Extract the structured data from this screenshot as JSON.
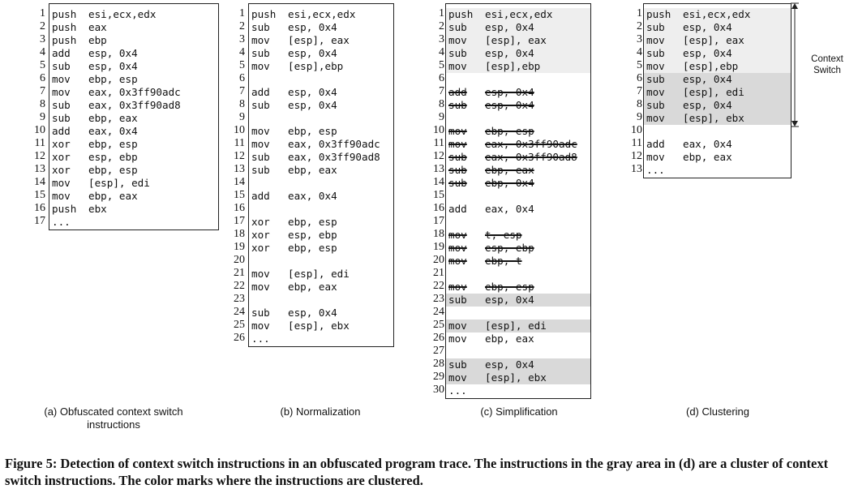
{
  "panels": [
    {
      "id": "a",
      "caption": "(a) Obfuscated context switch instructions",
      "rows": [
        {
          "n": "1",
          "op": "push",
          "args": "esi,ecx,edx",
          "style": ""
        },
        {
          "n": "2",
          "op": "push",
          "args": "eax",
          "style": ""
        },
        {
          "n": "3",
          "op": "push",
          "args": "ebp",
          "style": ""
        },
        {
          "n": "4",
          "op": "add",
          "args": "esp, 0x4",
          "style": ""
        },
        {
          "n": "5",
          "op": "sub",
          "args": "esp, 0x4",
          "style": ""
        },
        {
          "n": "6",
          "op": "mov",
          "args": "ebp, esp",
          "style": ""
        },
        {
          "n": "7",
          "op": "mov",
          "args": "eax, 0x3ff90adc",
          "style": ""
        },
        {
          "n": "8",
          "op": "sub",
          "args": "eax, 0x3ff90ad8",
          "style": ""
        },
        {
          "n": "9",
          "op": "sub",
          "args": "ebp, eax",
          "style": ""
        },
        {
          "n": "10",
          "op": "add",
          "args": "eax, 0x4",
          "style": ""
        },
        {
          "n": "11",
          "op": "xor",
          "args": "ebp, esp",
          "style": ""
        },
        {
          "n": "12",
          "op": "xor",
          "args": "esp, ebp",
          "style": ""
        },
        {
          "n": "13",
          "op": "xor",
          "args": "ebp, esp",
          "style": ""
        },
        {
          "n": "14",
          "op": "mov",
          "args": "[esp], edi",
          "style": ""
        },
        {
          "n": "15",
          "op": "mov",
          "args": "ebp, eax",
          "style": ""
        },
        {
          "n": "16",
          "op": "push",
          "args": "ebx",
          "style": ""
        },
        {
          "n": "17",
          "op": "...",
          "args": "",
          "style": ""
        }
      ]
    },
    {
      "id": "b",
      "caption": "(b) Normalization",
      "rows": [
        {
          "n": "1",
          "op": "push",
          "args": "esi,ecx,edx",
          "style": ""
        },
        {
          "n": "2",
          "op": "sub",
          "args": "esp, 0x4",
          "style": ""
        },
        {
          "n": "3",
          "op": "mov",
          "args": "[esp], eax",
          "style": ""
        },
        {
          "n": "4",
          "op": "sub",
          "args": "esp, 0x4",
          "style": ""
        },
        {
          "n": "5",
          "op": "mov",
          "args": "[esp],ebp",
          "style": ""
        },
        {
          "n": "6",
          "op": "",
          "args": "",
          "style": ""
        },
        {
          "n": "7",
          "op": "add",
          "args": "esp, 0x4",
          "style": ""
        },
        {
          "n": "8",
          "op": "sub",
          "args": "esp, 0x4",
          "style": ""
        },
        {
          "n": "9",
          "op": "",
          "args": "",
          "style": ""
        },
        {
          "n": "10",
          "op": "mov",
          "args": "ebp, esp",
          "style": ""
        },
        {
          "n": "11",
          "op": "mov",
          "args": "eax, 0x3ff90adc",
          "style": ""
        },
        {
          "n": "12",
          "op": "sub",
          "args": "eax, 0x3ff90ad8",
          "style": ""
        },
        {
          "n": "13",
          "op": "sub",
          "args": "ebp, eax",
          "style": ""
        },
        {
          "n": "14",
          "op": "",
          "args": "",
          "style": ""
        },
        {
          "n": "15",
          "op": "add",
          "args": "eax, 0x4",
          "style": ""
        },
        {
          "n": "16",
          "op": "",
          "args": "",
          "style": ""
        },
        {
          "n": "17",
          "op": "xor",
          "args": "ebp, esp",
          "style": ""
        },
        {
          "n": "18",
          "op": "xor",
          "args": "esp, ebp",
          "style": ""
        },
        {
          "n": "19",
          "op": "xor",
          "args": "ebp, esp",
          "style": ""
        },
        {
          "n": "20",
          "op": "",
          "args": "",
          "style": ""
        },
        {
          "n": "21",
          "op": "mov",
          "args": "[esp], edi",
          "style": ""
        },
        {
          "n": "22",
          "op": "mov",
          "args": "ebp, eax",
          "style": ""
        },
        {
          "n": "23",
          "op": "",
          "args": "",
          "style": ""
        },
        {
          "n": "24",
          "op": "sub",
          "args": "esp, 0x4",
          "style": ""
        },
        {
          "n": "25",
          "op": "mov",
          "args": "[esp], ebx",
          "style": ""
        },
        {
          "n": "26",
          "op": "...",
          "args": "",
          "style": ""
        }
      ]
    },
    {
      "id": "c",
      "caption": "(c) Simplification",
      "rows": [
        {
          "n": "1",
          "op": "push",
          "args": "esi,ecx,edx",
          "style": "hl"
        },
        {
          "n": "2",
          "op": "sub",
          "args": "esp, 0x4",
          "style": "hl"
        },
        {
          "n": "3",
          "op": "mov",
          "args": "[esp], eax",
          "style": "hl"
        },
        {
          "n": "4",
          "op": "sub",
          "args": "esp, 0x4",
          "style": "hl"
        },
        {
          "n": "5",
          "op": "mov",
          "args": "[esp],ebp",
          "style": "hl"
        },
        {
          "n": "6",
          "op": "",
          "args": "",
          "style": ""
        },
        {
          "n": "7",
          "op": "add",
          "args": "esp, 0x4",
          "style": "strike"
        },
        {
          "n": "8",
          "op": "sub",
          "args": "esp, 0x4",
          "style": "strike"
        },
        {
          "n": "9",
          "op": "",
          "args": "",
          "style": ""
        },
        {
          "n": "10",
          "op": "mov",
          "args": "ebp, esp",
          "style": "strike"
        },
        {
          "n": "11",
          "op": "mov",
          "args": "eax, 0x3ff90adc",
          "style": "strike"
        },
        {
          "n": "12",
          "op": "sub",
          "args": "eax, 0x3ff90ad8",
          "style": "strike"
        },
        {
          "n": "13",
          "op": "sub",
          "args": "ebp, eax",
          "style": "strike"
        },
        {
          "n": "14",
          "op": "sub",
          "args": "ebp, 0x4",
          "style": "strike"
        },
        {
          "n": "15",
          "op": "",
          "args": "",
          "style": ""
        },
        {
          "n": "16",
          "op": "add",
          "args": "eax, 0x4",
          "style": ""
        },
        {
          "n": "17",
          "op": "",
          "args": "",
          "style": ""
        },
        {
          "n": "18",
          "op": "mov",
          "args": "t, esp",
          "style": "strike"
        },
        {
          "n": "19",
          "op": "mov",
          "args": "esp, ebp",
          "style": "strike"
        },
        {
          "n": "20",
          "op": "mov",
          "args": "ebp, t",
          "style": "strike"
        },
        {
          "n": "21",
          "op": "",
          "args": "",
          "style": ""
        },
        {
          "n": "22",
          "op": "mov",
          "args": "ebp, esp",
          "style": "strike"
        },
        {
          "n": "23",
          "op": "sub",
          "args": "esp, 0x4",
          "style": "hl2"
        },
        {
          "n": "24",
          "op": "",
          "args": "",
          "style": ""
        },
        {
          "n": "25",
          "op": "mov",
          "args": "[esp], edi",
          "style": "hl2"
        },
        {
          "n": "26",
          "op": "mov",
          "args": "ebp, eax",
          "style": ""
        },
        {
          "n": "27",
          "op": "",
          "args": "",
          "style": ""
        },
        {
          "n": "28",
          "op": "sub",
          "args": "esp, 0x4",
          "style": "hl2"
        },
        {
          "n": "29",
          "op": "mov",
          "args": "[esp], ebx",
          "style": "hl2"
        },
        {
          "n": "30",
          "op": "...",
          "args": "",
          "style": ""
        }
      ]
    },
    {
      "id": "d",
      "caption": "(d) Clustering",
      "rows": [
        {
          "n": "1",
          "op": "push",
          "args": "esi,ecx,edx",
          "style": "hl"
        },
        {
          "n": "2",
          "op": "sub",
          "args": "esp, 0x4",
          "style": "hl"
        },
        {
          "n": "3",
          "op": "mov",
          "args": "[esp], eax",
          "style": "hl"
        },
        {
          "n": "4",
          "op": "sub",
          "args": "esp, 0x4",
          "style": "hl"
        },
        {
          "n": "5",
          "op": "mov",
          "args": "[esp],ebp",
          "style": "hl"
        },
        {
          "n": "6",
          "op": "sub",
          "args": "esp, 0x4",
          "style": "hl2"
        },
        {
          "n": "7",
          "op": "mov",
          "args": "[esp], edi",
          "style": "hl2"
        },
        {
          "n": "8",
          "op": "sub",
          "args": "esp, 0x4",
          "style": "hl2"
        },
        {
          "n": "9",
          "op": "mov",
          "args": "[esp], ebx",
          "style": "hl2"
        },
        {
          "n": "10",
          "op": "",
          "args": "",
          "style": ""
        },
        {
          "n": "11",
          "op": "add",
          "args": "eax, 0x4",
          "style": ""
        },
        {
          "n": "12",
          "op": "mov",
          "args": "ebp, eax",
          "style": ""
        },
        {
          "n": "13",
          "op": "...",
          "args": "",
          "style": ""
        }
      ]
    }
  ],
  "context_switch_label": "Context Switch",
  "figure_caption": "Figure 5: Detection of context switch instructions in an obfuscated program trace. The instructions in the gray area in (d) are a cluster of context switch instructions. The color marks where the instructions are clustered.",
  "colors": {
    "highlight_light": "#eeeeee",
    "highlight_dark": "#d9d9d9",
    "border": "#222222"
  }
}
